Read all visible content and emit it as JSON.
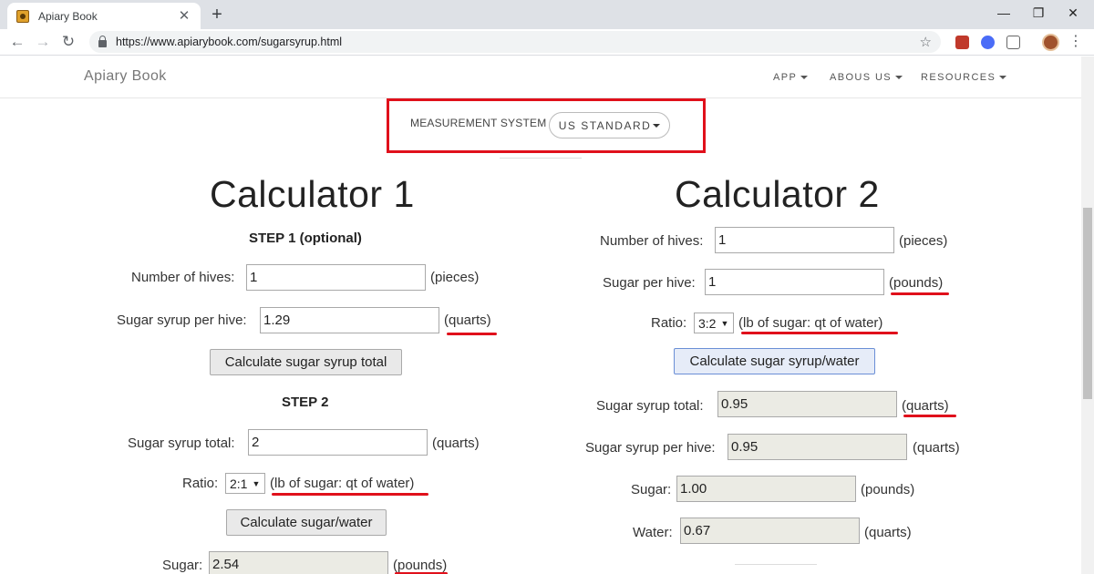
{
  "browser": {
    "tab_title": "Apiary Book",
    "tab_close": "✕",
    "new_tab": "+",
    "url": "https://www.apiarybook.com/sugarsyrup.html",
    "win_minimize": "—",
    "win_restore": "❐",
    "win_close": "✕"
  },
  "site": {
    "brand": "Apiary Book",
    "nav": [
      "APP",
      "ABOUS US",
      "RESOURCES"
    ]
  },
  "measurement": {
    "label": "MEASUREMENT SYSTEM",
    "value": "US STANDARD"
  },
  "calc1": {
    "title": "Calculator 1",
    "step1": "STEP 1 (optional)",
    "hives_label": "Number of hives:",
    "hives_value": "1",
    "hives_unit": "(pieces)",
    "syrup_per_hive_label": "Sugar syrup per hive:",
    "syrup_per_hive_value": "1.29",
    "syrup_per_hive_unit": "(quarts)",
    "calc_total_button": "Calculate sugar syrup total",
    "step2": "STEP 2",
    "syrup_total_label": "Sugar syrup total:",
    "syrup_total_value": "2",
    "syrup_total_unit": "(quarts)",
    "ratio_label": "Ratio:",
    "ratio_value": "2:1",
    "ratio_unit": "(lb of sugar: qt of water)",
    "calc_sugar_button": "Calculate sugar/water",
    "sugar_label": "Sugar:",
    "sugar_value": "2.54",
    "sugar_unit": "(pounds)"
  },
  "calc2": {
    "title": "Calculator 2",
    "hives_label": "Number of hives:",
    "hives_value": "1",
    "hives_unit": "(pieces)",
    "sugar_per_hive_label": "Sugar per hive:",
    "sugar_per_hive_value": "1",
    "sugar_per_hive_unit": "(pounds)",
    "ratio_label": "Ratio:",
    "ratio_value": "3:2",
    "ratio_unit": "(lb of sugar: qt of water)",
    "calc_button": "Calculate sugar syrup/water",
    "syrup_total_label": "Sugar syrup total:",
    "syrup_total_value": "0.95",
    "syrup_total_unit": "(quarts)",
    "syrup_per_hive_label": "Sugar syrup per hive:",
    "syrup_per_hive_value": "0.95",
    "syrup_per_hive_unit": "(quarts)",
    "sugar_label": "Sugar:",
    "sugar_value": "1.00",
    "sugar_unit": "(pounds)",
    "water_label": "Water:",
    "water_value": "0.67",
    "water_unit": "(quarts)"
  },
  "colors": {
    "annotation_red": "#e0101b",
    "readonly_bg": "#ebebe4"
  }
}
